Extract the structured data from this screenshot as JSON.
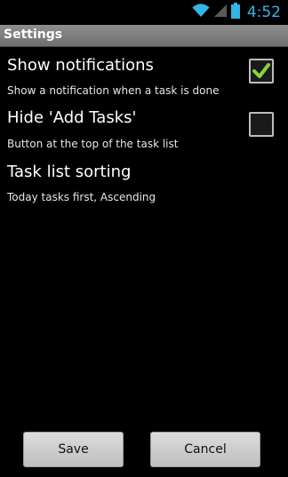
{
  "status_bar": {
    "time": "4:52",
    "icons": [
      "wifi-icon",
      "signal-icon",
      "battery-icon"
    ],
    "accent_color": "#33b5e5"
  },
  "title_bar": {
    "title": "Settings"
  },
  "preferences": [
    {
      "title": "Show notifications",
      "summary": "Show a notification when a task is done",
      "checked": true
    },
    {
      "title": "Hide 'Add Tasks'",
      "summary": "Button at the top of the task list",
      "checked": false
    },
    {
      "title": "Task list sorting",
      "summary": "Today tasks first, Ascending"
    }
  ],
  "buttons": {
    "save_label": "Save",
    "cancel_label": "Cancel"
  },
  "colors": {
    "checkmark": "#8bd43a",
    "title_bar": "#7f7f7f"
  }
}
